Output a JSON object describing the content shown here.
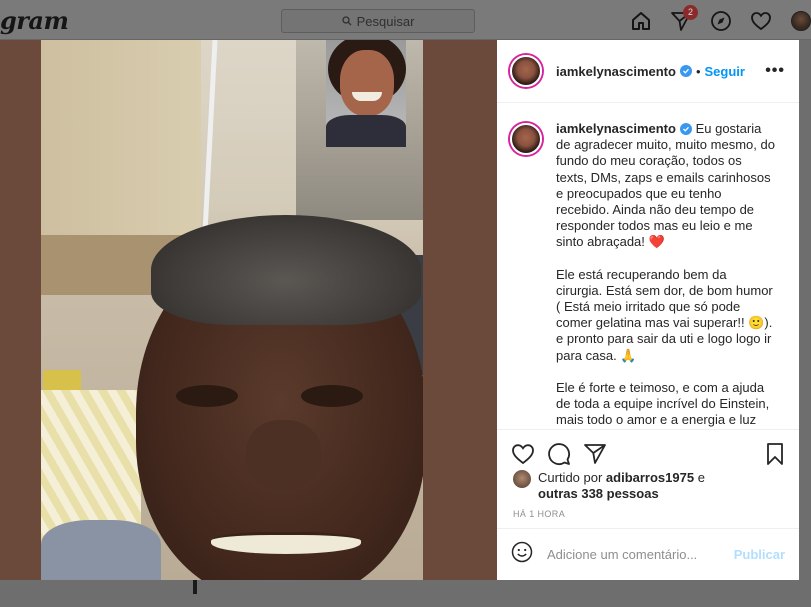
{
  "nav": {
    "logo_text": "gram",
    "search_placeholder": "Pesquisar",
    "notification_count": "2",
    "icons": [
      "home-icon",
      "direct-icon",
      "explore-icon",
      "activity-icon",
      "profile-avatar"
    ]
  },
  "post": {
    "username": "iamkelynascimento",
    "follow_label": "Seguir",
    "more_label": "•••",
    "dot": "•",
    "caption_p1": "Eu gostaria de agradecer muito, muito mesmo, do fundo do meu coração, todos os texts, DMs, zaps e emails carinhosos e preocupados que eu tenho recebido. Ainda não deu tempo de responder todos mas eu leio e me sinto abraçada! ",
    "caption_p1_emoji": "❤️",
    "caption_p2": "Ele está recuperando bem da cirurgia. Está sem dor, de bom humor ( Está meio irritado que só pode comer gelatina mas vai superar!! 🙂). e pronto para sair da uti e logo logo ir para casa. 🙏",
    "caption_p3": "Ele é forte e teimoso, e com a ajuda de toda a equipe incrível do Einstein, mais todo o amor e a energia e luz",
    "liked_by_prefix": "Curtido por ",
    "liked_by_user": "adibarros1975",
    "liked_by_and": " e",
    "liked_by_others": "outras 338 pessoas",
    "timestamp": "HÁ 1 HORA",
    "comment_placeholder": "Adicione um comentário...",
    "publish_label": "Publicar"
  },
  "colors": {
    "accent": "#0095f6",
    "publish_disabled": "#b2dffc",
    "verified": "#3897f0",
    "media_bg": "#6b4a3b"
  }
}
